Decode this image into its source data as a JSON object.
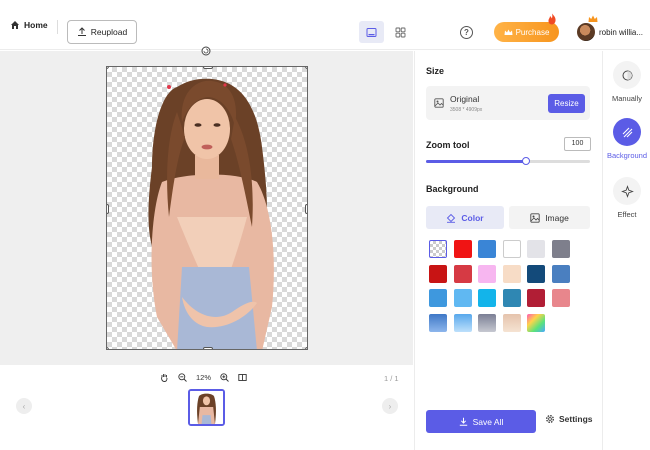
{
  "header": {
    "home_label": "Home",
    "reupload_label": "Reupload",
    "purchase_label": "Purchase",
    "username": "robin willia..."
  },
  "canvas": {
    "zoom_percent": "12%",
    "page_count": "1 / 1"
  },
  "panel": {
    "size_title": "Size",
    "size_name": "Original",
    "size_dims": "3508 * 4909px",
    "resize_label": "Resize",
    "zoom_title": "Zoom tool",
    "zoom_value": "100",
    "zoom_slider_fraction": 0.61,
    "background_title": "Background",
    "tab_color": "Color",
    "tab_image": "Image",
    "swatches": [
      "transparent",
      "#f01414",
      "#3a85d6",
      "#ffffff",
      "#e3e3e8",
      "#7e7f8c",
      "#c81414",
      "#d63a44",
      "#f7b6f0",
      "#f7dcc6",
      "#134a7a",
      "#4a7fc0",
      "#3e98de",
      "#60b8f2",
      "#13b4ea",
      "#2f87b3",
      "#b11e35",
      "#e8868c",
      "gradient-blue-1",
      "gradient-blue-2",
      "gradient-gray",
      "gradient-peach",
      "gradient-rainbow"
    ],
    "save_all_label": "Save All",
    "settings_label": "Settings"
  },
  "tools": [
    {
      "label": "Manually",
      "icon": "eraser-icon",
      "active": false
    },
    {
      "label": "Background",
      "icon": "background-icon",
      "active": true
    },
    {
      "label": "Effect",
      "icon": "effect-icon",
      "active": false
    }
  ],
  "colors": {
    "accent": "#5b5ce6",
    "purchase": "#f7951e"
  }
}
